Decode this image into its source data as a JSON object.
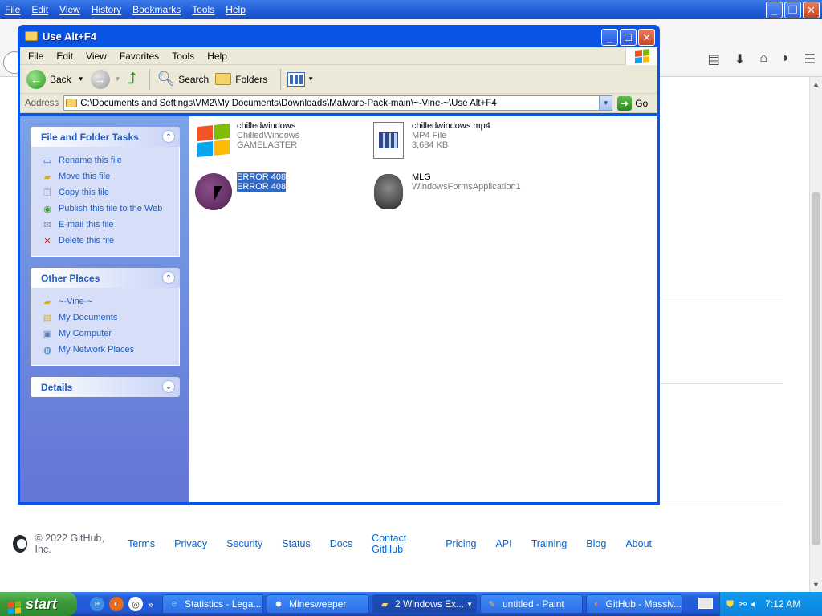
{
  "browser": {
    "menu": [
      "File",
      "Edit",
      "View",
      "History",
      "Bookmarks",
      "Tools",
      "Help"
    ],
    "toolbar_icons": [
      "reader-icon",
      "download-icon",
      "home-icon",
      "pocket-icon",
      "menu-icon"
    ]
  },
  "github_footer": {
    "copyright": "© 2022 GitHub, Inc.",
    "links": [
      "Terms",
      "Privacy",
      "Security",
      "Status",
      "Docs",
      "Contact GitHub",
      "Pricing",
      "API",
      "Training",
      "Blog",
      "About"
    ]
  },
  "explorer": {
    "title": "Use Alt+F4",
    "menu": [
      "File",
      "Edit",
      "View",
      "Favorites",
      "Tools",
      "Help"
    ],
    "toolbar": {
      "back": "Back",
      "search": "Search",
      "folders": "Folders"
    },
    "address_label": "Address",
    "address_value": "C:\\Documents and Settings\\VM2\\My Documents\\Downloads\\Malware-Pack-main\\~-Vine-~\\Use Alt+F4",
    "go_label": "Go",
    "panels": {
      "file_tasks": {
        "title": "File and Folder Tasks",
        "items": [
          "Rename this file",
          "Move this file",
          "Copy this file",
          "Publish this file to the Web",
          "E-mail this file",
          "Delete this file"
        ]
      },
      "other_places": {
        "title": "Other Places",
        "items": [
          "~-Vine-~",
          "My Documents",
          "My Computer",
          "My Network Places"
        ]
      },
      "details": {
        "title": "Details"
      }
    },
    "files": [
      {
        "name": "chilledwindows",
        "line2": "ChilledWindows",
        "line3": "GAMELASTER"
      },
      {
        "name": "chilledwindows.mp4",
        "line2": "MP4 File",
        "line3": "3,684 KB"
      },
      {
        "name": "ERROR 408",
        "line2": "ERROR 408",
        "line3": ""
      },
      {
        "name": "MLG",
        "line2": "WindowsFormsApplication1",
        "line3": ""
      }
    ]
  },
  "taskbar": {
    "start": "start",
    "buttons": [
      "Statistics - Lega...",
      "Minesweeper",
      "2 Windows Ex...",
      "untitled - Paint",
      "GitHub - Massiv..."
    ],
    "clock": "7:12 AM"
  },
  "colors": {
    "xp_blue": "#0a54e3",
    "task_link": "#215dc6",
    "selection": "#316ac5",
    "start_green": "#3c9a3c"
  }
}
